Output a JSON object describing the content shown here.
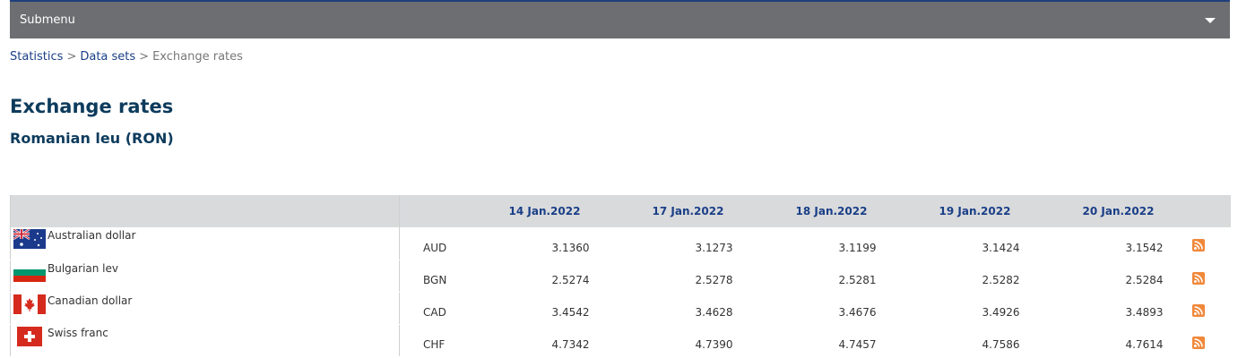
{
  "submenu": {
    "label": "Submenu"
  },
  "breadcrumb": {
    "items": [
      "Statistics",
      "Data sets"
    ],
    "separator": ">",
    "current": "Exchange rates"
  },
  "page": {
    "title": "Exchange rates",
    "subtitle": "Romanian leu (RON)"
  },
  "table": {
    "dates": [
      "14 Jan.2022",
      "17 Jan.2022",
      "18 Jan.2022",
      "19 Jan.2022",
      "20 Jan.2022"
    ],
    "rows": [
      {
        "name": "Australian dollar",
        "code": "AUD",
        "values": [
          "3.1360",
          "3.1273",
          "3.1199",
          "3.1424",
          "3.1542"
        ],
        "flag_icon": "australia-flag-icon"
      },
      {
        "name": "Bulgarian lev",
        "code": "BGN",
        "values": [
          "2.5274",
          "2.5278",
          "2.5281",
          "2.5282",
          "2.5284"
        ],
        "flag_icon": "bulgaria-flag-icon"
      },
      {
        "name": "Canadian dollar",
        "code": "CAD",
        "values": [
          "3.4542",
          "3.4628",
          "3.4676",
          "3.4926",
          "3.4893"
        ],
        "flag_icon": "canada-flag-icon"
      },
      {
        "name": "Swiss franc",
        "code": "CHF",
        "values": [
          "4.7342",
          "4.7390",
          "4.7457",
          "4.7586",
          "4.7614"
        ],
        "flag_icon": "switzerland-flag-icon"
      }
    ]
  },
  "colors": {
    "submenu_bg": "#6d6e71",
    "accent": "#1a3f87",
    "title": "#0d3b5c",
    "header_bg": "#d9dadc",
    "rss": "#f0883a"
  }
}
